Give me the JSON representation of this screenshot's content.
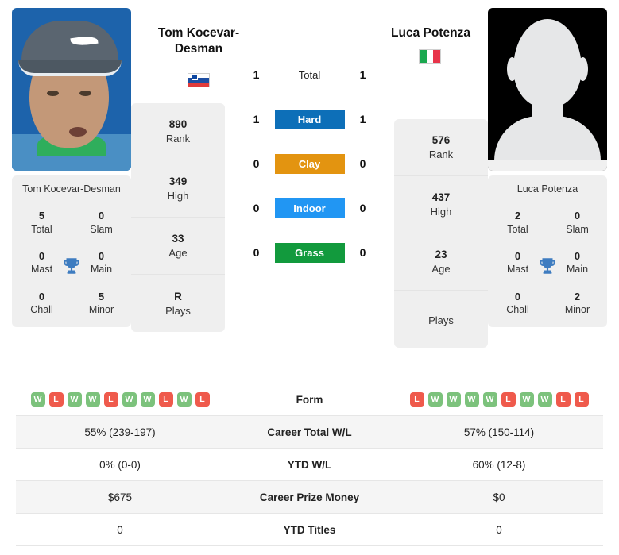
{
  "players": {
    "left": {
      "display_name": "Tom Kocevar-Desman",
      "header_name_line1": "Tom Kocevar-",
      "header_name_line2": "Desman",
      "country_flag": "slovenia-flag",
      "photo": "player-photo",
      "rank": "890",
      "rank_label": "Rank",
      "high": "349",
      "high_label": "High",
      "age": "33",
      "age_label": "Age",
      "plays": "R",
      "plays_label": "Plays",
      "titles": {
        "total": "5",
        "total_label": "Total",
        "slam": "0",
        "slam_label": "Slam",
        "mast": "0",
        "mast_label": "Mast",
        "main": "0",
        "main_label": "Main",
        "chall": "0",
        "chall_label": "Chall",
        "minor": "5",
        "minor_label": "Minor"
      },
      "surface_wins": {
        "total": "1",
        "hard": "1",
        "clay": "0",
        "indoor": "0",
        "grass": "0"
      },
      "form": [
        "W",
        "L",
        "W",
        "W",
        "L",
        "W",
        "W",
        "L",
        "W",
        "L"
      ],
      "career_total_wl": "55% (239-197)",
      "ytd_wl": "0% (0-0)",
      "career_prize_money": "$675",
      "ytd_titles": "0"
    },
    "right": {
      "display_name": "Luca Potenza",
      "header_name_line1": "Luca Potenza",
      "header_name_line2": "",
      "country_flag": "italy-flag",
      "photo": "player-photo-placeholder",
      "rank": "576",
      "rank_label": "Rank",
      "high": "437",
      "high_label": "High",
      "age": "23",
      "age_label": "Age",
      "plays": "",
      "plays_label": "Plays",
      "titles": {
        "total": "2",
        "total_label": "Total",
        "slam": "0",
        "slam_label": "Slam",
        "mast": "0",
        "mast_label": "Mast",
        "main": "0",
        "main_label": "Main",
        "chall": "0",
        "chall_label": "Chall",
        "minor": "2",
        "minor_label": "Minor"
      },
      "surface_wins": {
        "total": "1",
        "hard": "1",
        "clay": "0",
        "indoor": "0",
        "grass": "0"
      },
      "form": [
        "L",
        "W",
        "W",
        "W",
        "W",
        "L",
        "W",
        "W",
        "L",
        "L"
      ],
      "career_total_wl": "57% (150-114)",
      "ytd_wl": "60% (12-8)",
      "career_prize_money": "$0",
      "ytd_titles": "0"
    }
  },
  "surfaces": {
    "total_label": "Total",
    "hard_label": "Hard",
    "clay_label": "Clay",
    "indoor_label": "Indoor",
    "grass_label": "Grass",
    "colors": {
      "hard": "#0d6fb8",
      "clay": "#e39410",
      "indoor": "#2196f3",
      "grass": "#129a3d"
    }
  },
  "table_labels": {
    "form": "Form",
    "career_total_wl": "Career Total W/L",
    "ytd_wl": "YTD W/L",
    "career_prize_money": "Career Prize Money",
    "ytd_titles": "YTD Titles"
  },
  "badge_colors": {
    "win": "#7cc27c",
    "loss": "#ef5a4c"
  },
  "icons": {
    "trophy": "trophy-icon"
  }
}
